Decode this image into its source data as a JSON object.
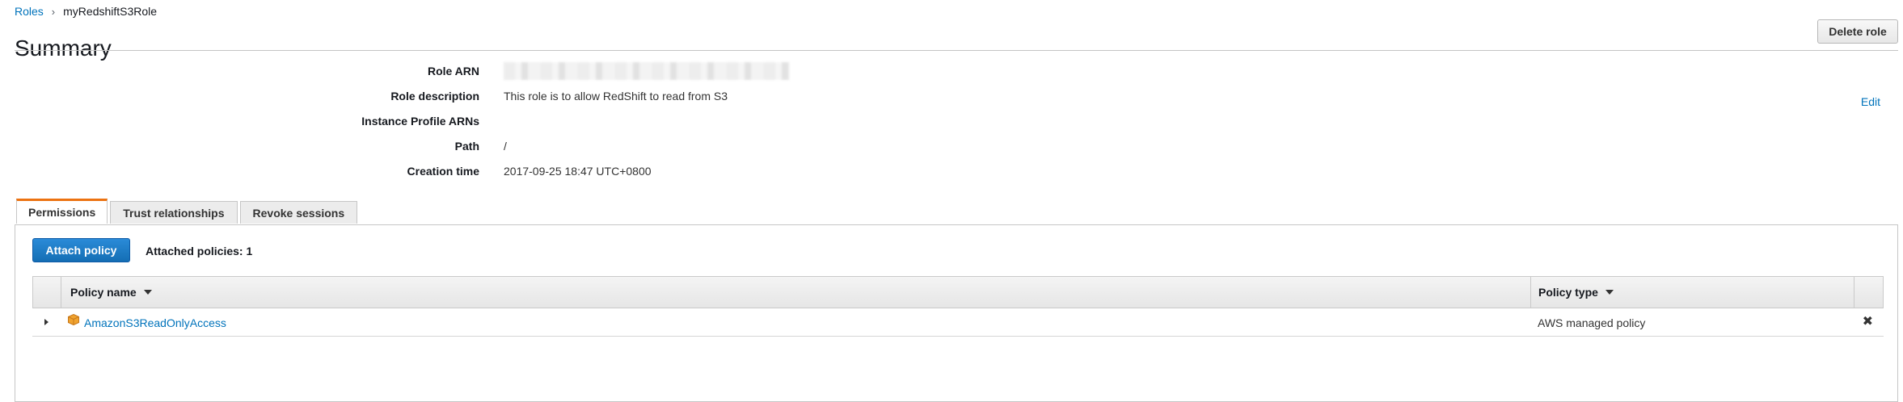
{
  "breadcrumb": {
    "parent": "Roles",
    "separator": "›",
    "current": "myRedshiftS3Role"
  },
  "header": {
    "title": "Summary",
    "delete_label": "Delete role"
  },
  "summary": {
    "rows": [
      {
        "label": "Role ARN",
        "value": ""
      },
      {
        "label": "Role description",
        "value": "This role is to allow RedShift to read from S3"
      },
      {
        "label": "Instance Profile ARNs",
        "value": ""
      },
      {
        "label": "Path",
        "value": "/"
      },
      {
        "label": "Creation time",
        "value": "2017-09-25 18:47 UTC+0800"
      }
    ],
    "edit_label": "Edit"
  },
  "tabs": [
    {
      "label": "Permissions",
      "active": true
    },
    {
      "label": "Trust relationships",
      "active": false
    },
    {
      "label": "Revoke sessions",
      "active": false
    }
  ],
  "permissions": {
    "attach_label": "Attach policy",
    "attached_count": "Attached policies: 1",
    "columns": {
      "name": "Policy name",
      "type": "Policy type"
    },
    "rows": [
      {
        "name": "AmazonS3ReadOnlyAccess",
        "type": "AWS managed policy",
        "icon": "policy-box-icon"
      }
    ],
    "remove_icon": "close-icon"
  },
  "colors": {
    "accent": "#ec7211",
    "link": "#0073bb",
    "primary": "#146eb4"
  }
}
